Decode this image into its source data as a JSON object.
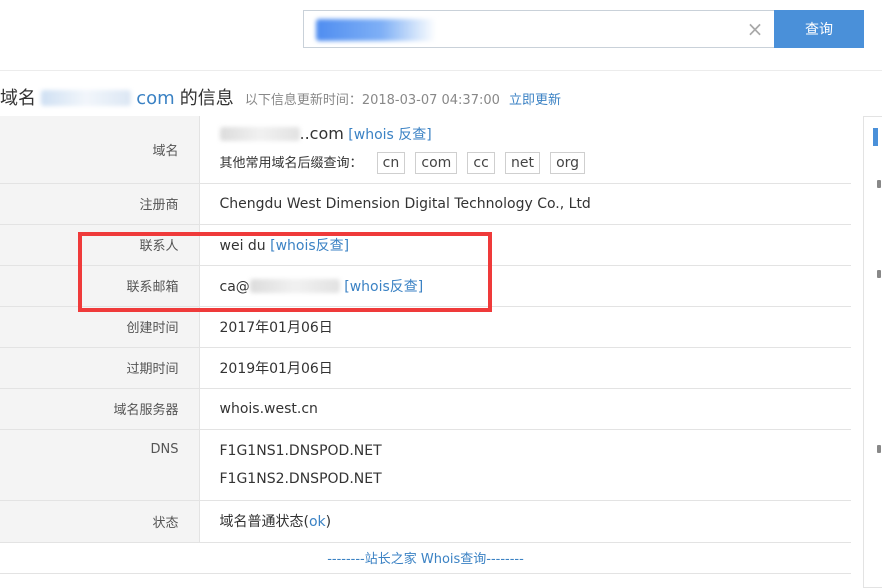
{
  "search": {
    "value": "",
    "button_label": "查询",
    "clear_icon": "×"
  },
  "title": {
    "prefix": "域名",
    "domain_suffix": "com",
    "suffix": "的信息",
    "update_label": "以下信息更新时间：2018-03-07 04:37:00",
    "update_link": "立即更新"
  },
  "rows": {
    "domain": {
      "label": "域名",
      "value_suffix": "..com",
      "whois_link": "[whois 反查]",
      "suffix_label": "其他常用域名后缀查询：",
      "suffixes": [
        "cn",
        "com",
        "cc",
        "net",
        "org"
      ]
    },
    "registrar": {
      "label": "注册商",
      "value": "Chengdu West Dimension Digital Technology Co., Ltd"
    },
    "contact": {
      "label": "联系人",
      "value": "wei du",
      "whois_link": "[whois反查]"
    },
    "email": {
      "label": "联系邮箱",
      "value_prefix": "ca@",
      "whois_link": "[whois反查]"
    },
    "created": {
      "label": "创建时间",
      "value": "2017年01月06日"
    },
    "expires": {
      "label": "过期时间",
      "value": "2019年01月06日"
    },
    "whois_server": {
      "label": "域名服务器",
      "value": "whois.west.cn"
    },
    "dns": {
      "label": "DNS",
      "values": [
        "F1G1NS1.DNSPOD.NET",
        "F1G1NS2.DNSPOD.NET"
      ]
    },
    "status": {
      "label": "状态",
      "value_prefix": "域名普通状态(",
      "status_link": "ok",
      "value_suffix": ")"
    }
  },
  "footer": {
    "link": "--------站长之家 Whois查询--------"
  },
  "colors": {
    "accent": "#4a90d9",
    "link": "#3b82c4",
    "highlight": "#ef3a3a"
  }
}
